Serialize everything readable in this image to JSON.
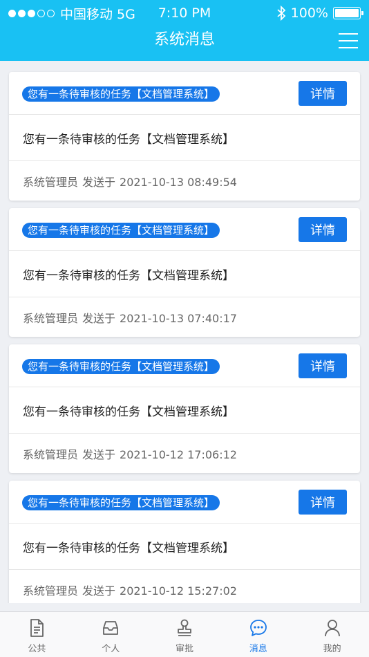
{
  "status_bar": {
    "carrier": "中国移动 5G",
    "time": "7:10 PM",
    "battery": "100%"
  },
  "header": {
    "title": "系统消息"
  },
  "messages": [
    {
      "tag": "您有一条待审核的任务【文档管理系统】",
      "button": "详情",
      "content": "您有一条待审核的任务【文档管理系统】",
      "sender": "系统管理员",
      "sent_label": "发送于",
      "time": "2021-10-13 08:49:54"
    },
    {
      "tag": "您有一条待审核的任务【文档管理系统】",
      "button": "详情",
      "content": "您有一条待审核的任务【文档管理系统】",
      "sender": "系统管理员",
      "sent_label": "发送于",
      "time": "2021-10-13 07:40:17"
    },
    {
      "tag": "您有一条待审核的任务【文档管理系统】",
      "button": "详情",
      "content": "您有一条待审核的任务【文档管理系统】",
      "sender": "系统管理员",
      "sent_label": "发送于",
      "time": "2021-10-12 17:06:12"
    },
    {
      "tag": "您有一条待审核的任务【文档管理系统】",
      "button": "详情",
      "content": "您有一条待审核的任务【文档管理系统】",
      "sender": "系统管理员",
      "sent_label": "发送于",
      "time": "2021-10-12 15:27:02"
    }
  ],
  "tabbar": {
    "items": [
      {
        "label": "公共",
        "icon": "document-icon"
      },
      {
        "label": "个人",
        "icon": "inbox-icon"
      },
      {
        "label": "审批",
        "icon": "stamp-icon"
      },
      {
        "label": "消息",
        "icon": "chat-bubble-icon"
      },
      {
        "label": "我的",
        "icon": "user-icon"
      }
    ],
    "active": "消息"
  },
  "colors": {
    "header": "#19c1f3",
    "accent": "#1677e8",
    "background": "#eef0f4"
  }
}
